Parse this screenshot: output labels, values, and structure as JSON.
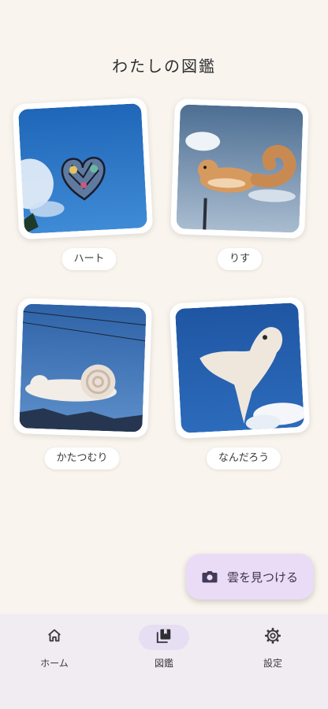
{
  "page": {
    "title": "わたしの図鑑"
  },
  "cards": [
    {
      "label": "ハート"
    },
    {
      "label": "りす"
    },
    {
      "label": "かたつむり"
    },
    {
      "label": "なんだろう"
    }
  ],
  "fab": {
    "label": "雲を見つける",
    "icon": "camera-icon"
  },
  "nav": {
    "items": [
      {
        "label": "ホーム",
        "icon": "home-icon"
      },
      {
        "label": "図鑑",
        "icon": "collection-icon",
        "active": true
      },
      {
        "label": "設定",
        "icon": "gear-icon"
      }
    ]
  },
  "colors": {
    "background": "#f9f5ee",
    "accent": "#eadcf6",
    "nav_background": "#f1ecf2",
    "sky": "#2f6fc0"
  }
}
